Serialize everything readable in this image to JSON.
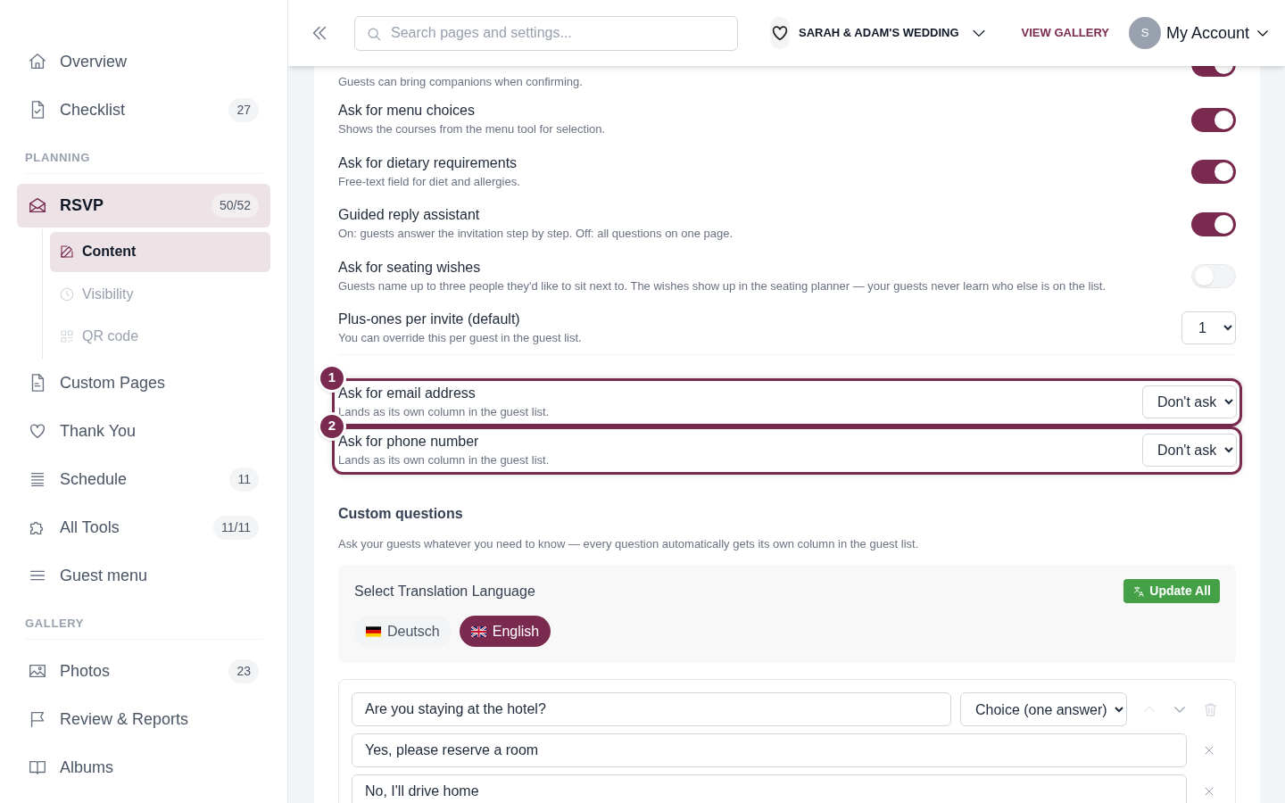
{
  "sidebar": {
    "items": [
      {
        "kind": "item",
        "label": "Overview",
        "selected": false
      },
      {
        "kind": "item",
        "label": "Checklist",
        "badge": "27",
        "selected": false
      },
      {
        "kind": "section",
        "label": "PLANNING"
      },
      {
        "kind": "item",
        "label": "RSVP",
        "badge": "50/52",
        "selected": true,
        "children": [
          {
            "label": "Content",
            "selected": true
          },
          {
            "label": "Visibility",
            "selected": false
          },
          {
            "label": "QR code",
            "selected": false
          }
        ]
      },
      {
        "kind": "item",
        "label": "Custom Pages",
        "selected": false
      },
      {
        "kind": "item",
        "label": "Thank You",
        "selected": false
      },
      {
        "kind": "item",
        "label": "Schedule",
        "badge": "11",
        "selected": false
      },
      {
        "kind": "item",
        "label": "All Tools",
        "badge": "11/11",
        "selected": false
      },
      {
        "kind": "item",
        "label": "Guest menu",
        "selected": false
      },
      {
        "kind": "section",
        "label": "GALLERY"
      },
      {
        "kind": "item",
        "label": "Photos",
        "badge": "23",
        "selected": false
      },
      {
        "kind": "item",
        "label": "Review & Reports",
        "selected": false
      },
      {
        "kind": "item",
        "label": "Albums",
        "selected": false
      }
    ]
  },
  "header": {
    "search": {
      "placeholder": "Search pages and settings..."
    },
    "event": "SARAH & ADAM'S WEDDING",
    "gallery_link": "VIEW GALLERY",
    "account": {
      "initial": "S",
      "label": "My Account"
    }
  },
  "settings": {
    "rows": [
      {
        "kind": "toggle",
        "description": "Guests can bring companions when confirming.",
        "on": true
      },
      {
        "kind": "toggle",
        "title": "Ask for menu choices",
        "description": "Shows the courses from the menu tool for selection.",
        "on": true
      },
      {
        "kind": "toggle",
        "title": "Ask for dietary requirements",
        "description": "Free-text field for diet and allergies.",
        "on": true
      },
      {
        "kind": "toggle",
        "title": "Guided reply assistant",
        "description": "On: guests answer the invitation step by step. Off: all questions on one page.",
        "on": true
      },
      {
        "kind": "toggle",
        "title": "Ask for seating wishes",
        "description": "Guests name up to three people they'd like to sit next to. The wishes show up in the seating planner — your guests never learn who else is on the list.",
        "on": false
      },
      {
        "kind": "select",
        "title": "Plus-ones per invite (default)",
        "description": "You can override this per guest in the guest list.",
        "value": "1"
      },
      {
        "kind": "select",
        "title": "Ask for email address",
        "description": "Lands as its own column in the guest list.",
        "value": "Don't ask",
        "marker": "1"
      },
      {
        "kind": "select",
        "title": "Ask for phone number",
        "description": "Lands as its own column in the guest list.",
        "value": "Don't ask",
        "marker": "2"
      }
    ]
  },
  "custom_questions": {
    "title": "Custom questions",
    "description": "Ask your guests whatever you need to know — every question automatically gets its own column in the guest list.",
    "translation": {
      "title": "Select Translation Language",
      "button": "Update All",
      "languages": [
        {
          "label": "Deutsch",
          "selected": false
        },
        {
          "label": "English",
          "selected": true
        }
      ]
    },
    "question": {
      "text": "Are you staying at the hotel?",
      "type": "Choice (one answer)",
      "options": [
        "Yes, please reserve a room",
        "No, I'll drive home"
      ]
    }
  }
}
